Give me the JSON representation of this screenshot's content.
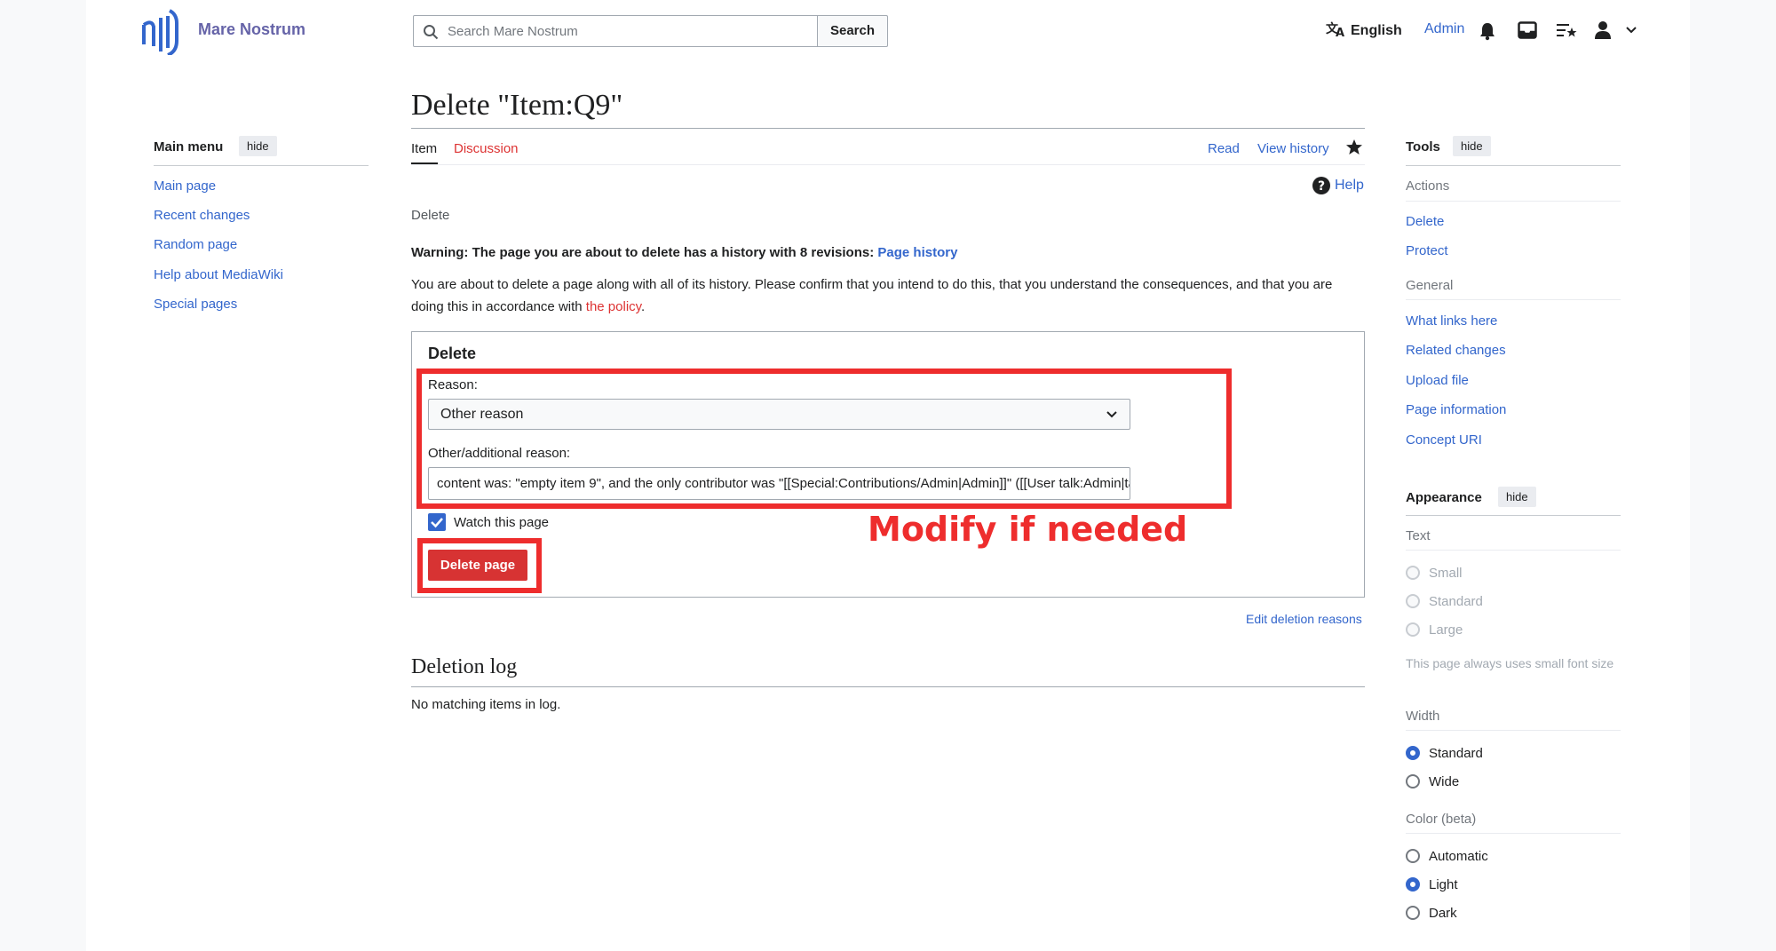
{
  "header": {
    "site_name": "Mare Nostrum",
    "search_placeholder": "Search Mare Nostrum",
    "search_button": "Search",
    "language": "English",
    "user": "Admin"
  },
  "main_menu": {
    "title": "Main menu",
    "hide": "hide",
    "items": [
      "Main page",
      "Recent changes",
      "Random page",
      "Help about MediaWiki",
      "Special pages"
    ]
  },
  "page": {
    "title": "Delete \"Item:Q9\"",
    "tabs": {
      "item": "Item",
      "discussion": "Discussion",
      "read": "Read",
      "view_history": "View history"
    },
    "help": "Help",
    "subtitle": "Delete",
    "warning_bold": "Warning:",
    "warning_text": " The page you are about to delete has a history with 8 revisions: ",
    "warning_link": "Page history",
    "intro": "You are about to delete a page along with all of its history. Please confirm that you intend to do this, that you understand the consequences, and that you are doing this in accordance with ",
    "intro_link": "the policy",
    "intro_end": "."
  },
  "form": {
    "legend": "Delete",
    "reason_label": "Reason:",
    "reason_value": "Other reason",
    "other_label": "Other/additional reason:",
    "other_value": "content was: \"empty item 9\", and the only contributor was \"[[Special:Contributions/Admin|Admin]]\" ([[User talk:Admin|talk]])",
    "watch_label": "Watch this page",
    "watch_checked": true,
    "delete_button": "Delete page",
    "edit_reasons": "Edit deletion reasons"
  },
  "annotation": {
    "text": "Modify if needed",
    "color": "#ee2d2d"
  },
  "deletion_log": {
    "title": "Deletion log",
    "text": "No matching items in log."
  },
  "tools": {
    "title": "Tools",
    "hide": "hide",
    "actions_heading": "Actions",
    "actions": [
      "Delete",
      "Protect"
    ],
    "general_heading": "General",
    "general": [
      "What links here",
      "Related changes",
      "Upload file",
      "Page information",
      "Concept URI"
    ]
  },
  "appearance": {
    "title": "Appearance",
    "hide": "hide",
    "text_heading": "Text",
    "text_options": [
      "Small",
      "Standard",
      "Large"
    ],
    "text_note": "This page always uses small font size",
    "width_heading": "Width",
    "width_options": [
      "Standard",
      "Wide"
    ],
    "width_selected": "Standard",
    "color_heading": "Color (beta)",
    "color_options": [
      "Automatic",
      "Light",
      "Dark"
    ],
    "color_selected": "Light"
  },
  "colors": {
    "link": "#3366cc",
    "red_link": "#d33",
    "destructive": "#d73333",
    "annotation": "#ee2d2d"
  }
}
